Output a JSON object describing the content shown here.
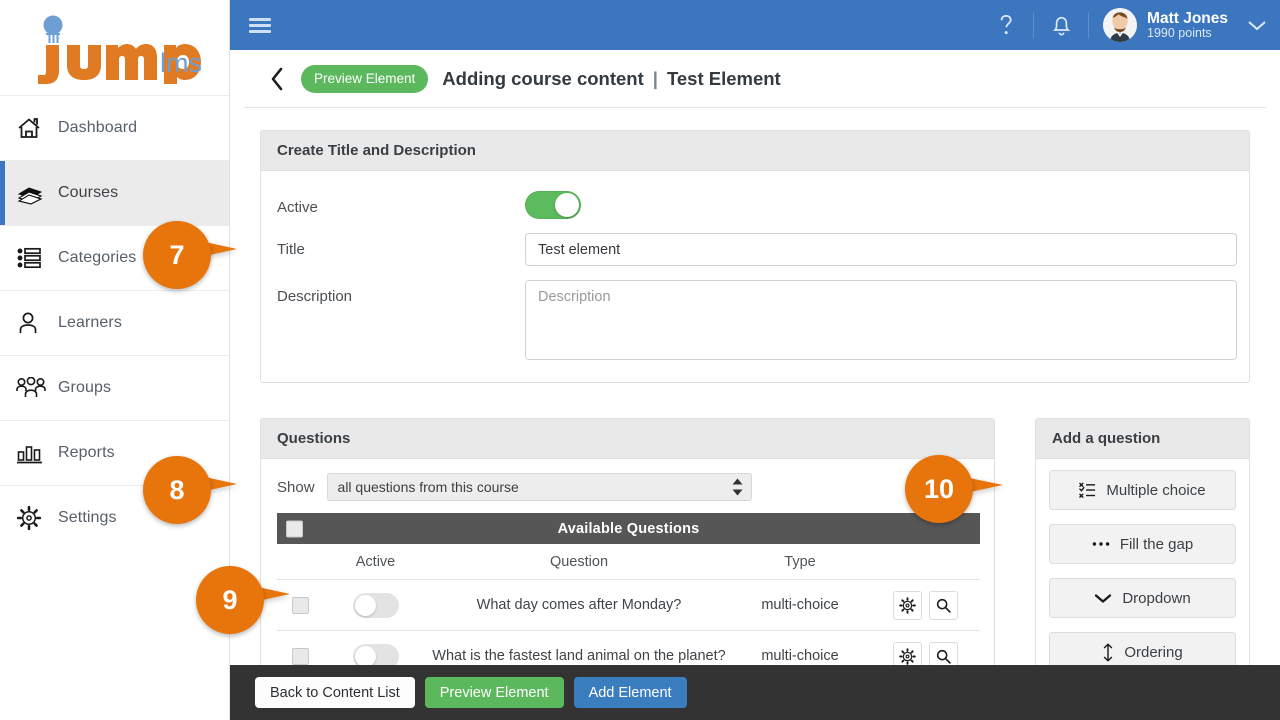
{
  "brand": {
    "name_jump": "jump",
    "name_lms": "lms",
    "color_orange": "#e07b24",
    "color_blue": "#6e9fd4"
  },
  "sidebar": {
    "items": [
      {
        "label": "Dashboard",
        "icon": "home-icon",
        "active": false
      },
      {
        "label": "Courses",
        "icon": "books-icon",
        "active": true
      },
      {
        "label": "Categories",
        "icon": "list-icon",
        "active": false
      },
      {
        "label": "Learners",
        "icon": "user-icon",
        "active": false
      },
      {
        "label": "Groups",
        "icon": "users-icon",
        "active": false
      },
      {
        "label": "Reports",
        "icon": "bar-chart-icon",
        "active": false
      },
      {
        "label": "Settings",
        "icon": "gear-icon",
        "active": false
      }
    ]
  },
  "topbar": {
    "menu_icon": "hamburger-icon",
    "help_icon": "question-mark-icon",
    "bell_icon": "bell-icon",
    "user_name": "Matt Jones",
    "user_points": "1990 points",
    "caret_icon": "chevron-down-icon",
    "background": "#3b76bf"
  },
  "breadcrumb": {
    "back_icon": "chevron-left-icon",
    "preview_pill": "Preview Element",
    "title": "Adding course content",
    "separator": "|",
    "subtitle": "Test Element"
  },
  "title_desc_card": {
    "header": "Create Title and Description",
    "active_label": "Active",
    "active_on": true,
    "title_label": "Title",
    "title_value": "Test element",
    "title_placeholder": "Title",
    "description_label": "Description",
    "description_value": "",
    "description_placeholder": "Description"
  },
  "questions_card": {
    "header": "Questions",
    "show_label": "Show",
    "show_value": "all questions from this course",
    "table_header": "Available Questions",
    "columns": [
      "Active",
      "Question",
      "Type"
    ],
    "rows": [
      {
        "question": "What day comes after Monday?",
        "type": "multi-choice",
        "active": false,
        "settings_icon": "settings-icon",
        "preview_icon": "search-icon"
      },
      {
        "question": "What is the fastest land animal on the planet?",
        "type": "multi-choice",
        "active": false,
        "settings_icon": "settings-icon",
        "preview_icon": "search-icon"
      }
    ]
  },
  "add_question_card": {
    "header": "Add a question",
    "buttons": [
      {
        "label": "Multiple choice",
        "icon": "checklist-icon"
      },
      {
        "label": "Fill the gap",
        "icon": "ellipsis-icon"
      },
      {
        "label": "Dropdown",
        "icon": "chevron-down-icon"
      },
      {
        "label": "Ordering",
        "icon": "updown-arrow-icon"
      }
    ]
  },
  "bottombar": {
    "back_label": "Back to Content List",
    "preview_label": "Preview Element",
    "add_label": "Add Element",
    "background": "#333333"
  },
  "callouts": [
    {
      "number": "7",
      "target": "title-field"
    },
    {
      "number": "8",
      "target": "show-select"
    },
    {
      "number": "9",
      "target": "row-active-toggle"
    },
    {
      "number": "10",
      "target": "multiple-choice-button"
    }
  ]
}
